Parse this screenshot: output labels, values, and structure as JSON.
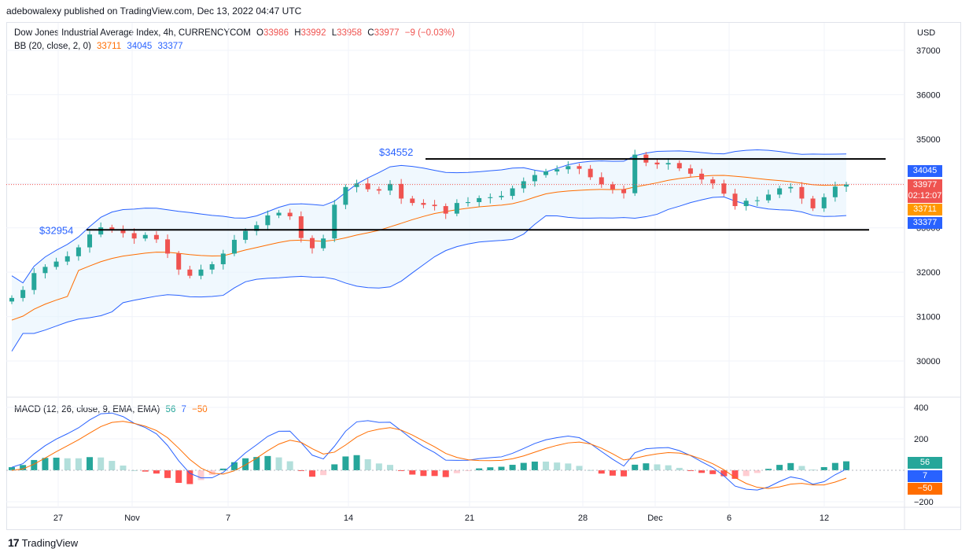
{
  "header": {
    "published": "adebowalexy published on TradingView.com, Dec 13, 2022 04:47 UTC"
  },
  "legend": {
    "symbol": "Dow Jones Industrial Average Index, 4h, CURRENCYCOM",
    "o_label": "O",
    "o": "33986",
    "h_label": "H",
    "h": "33992",
    "l_label": "L",
    "l": "33958",
    "c_label": "C",
    "c": "33977",
    "change": "−9 (−0.03%)",
    "bb_label": "BB (20, close, 2, 0)",
    "bb_basis": "33711",
    "bb_upper": "34045",
    "bb_lower": "33377",
    "macd_label": "MACD (12, 26, close, 9, EMA, EMA)",
    "macd_hist": "56",
    "macd_line": "7",
    "macd_signal": "−50"
  },
  "price_axis": {
    "currency": "USD",
    "ticks": [
      "37000",
      "36000",
      "35000",
      "34000",
      "33000",
      "32000",
      "31000",
      "30000"
    ]
  },
  "macd_axis": {
    "ticks": [
      "400",
      "200",
      "−200"
    ]
  },
  "time_axis": {
    "ticks": [
      "27",
      "Nov",
      "7",
      "14",
      "21",
      "28",
      "Dec",
      "6",
      "12"
    ]
  },
  "annotations": {
    "level_high": "$34552",
    "level_low": "$32954"
  },
  "price_tags": {
    "upper": "34045",
    "close": "33977",
    "countdown": "02:12:07",
    "basis": "33711",
    "lower": "33377",
    "macd_hist": "56",
    "macd_line": "7",
    "macd_signal": "−50"
  },
  "footer": {
    "brand": "TradingView"
  },
  "colors": {
    "up": "#26a69a",
    "down": "#ef5350",
    "bb_band": "#2962ff",
    "bb_basis": "#ff6d00",
    "bb_fill": "#e3f2fd",
    "macd_line": "#2962ff",
    "signal_line": "#ff6d00",
    "hist_up_strong": "#26a69a",
    "hist_up_weak": "#b2dfdb",
    "hist_down_strong": "#ff5252",
    "hist_down_weak": "#ffcdd2"
  },
  "chart_data": [
    {
      "type": "candlestick",
      "title": "Dow Jones Industrial Average Index, 4h, CURRENCYCOM",
      "ylabel": "USD",
      "ylim": [
        29500,
        37500
      ],
      "x_tick_labels": [
        "27",
        "Nov",
        "7",
        "14",
        "21",
        "28",
        "Dec",
        "6",
        "12"
      ],
      "close_path": [
        31420,
        31600,
        31980,
        32120,
        32240,
        32360,
        32560,
        32850,
        33010,
        32970,
        32880,
        32760,
        32840,
        32740,
        32420,
        32060,
        31920,
        32060,
        32180,
        32420,
        32730,
        32930,
        33060,
        33280,
        33340,
        33260,
        32770,
        32540,
        32760,
        33520,
        33920,
        34000,
        33870,
        33840,
        33990,
        33660,
        33560,
        33520,
        33490,
        33320,
        33560,
        33580,
        33670,
        33690,
        33720,
        33890,
        34050,
        34190,
        34270,
        34320,
        34390,
        34330,
        34140,
        33980,
        33870,
        33780,
        34650,
        34470,
        34430,
        34460,
        34340,
        34220,
        34090,
        34000,
        33770,
        33490,
        33610,
        33620,
        33750,
        33890,
        33920,
        33660,
        33440,
        33690,
        33930,
        33977
      ],
      "bollinger": {
        "period": 20,
        "mult": 2,
        "basis_last": 33711,
        "upper_last": 34045,
        "lower_last": 33377
      },
      "horizontal_levels": [
        {
          "label": "$34552",
          "value": 34552
        },
        {
          "label": "$32954",
          "value": 32954
        }
      ]
    },
    {
      "type": "bar",
      "title": "MACD (12, 26, close, 9, EMA, EMA)",
      "ylim": [
        -300,
        450
      ],
      "series": [
        {
          "name": "Histogram",
          "last": 56
        },
        {
          "name": "MACD",
          "last": 7
        },
        {
          "name": "Signal",
          "last": -50
        }
      ]
    }
  ]
}
